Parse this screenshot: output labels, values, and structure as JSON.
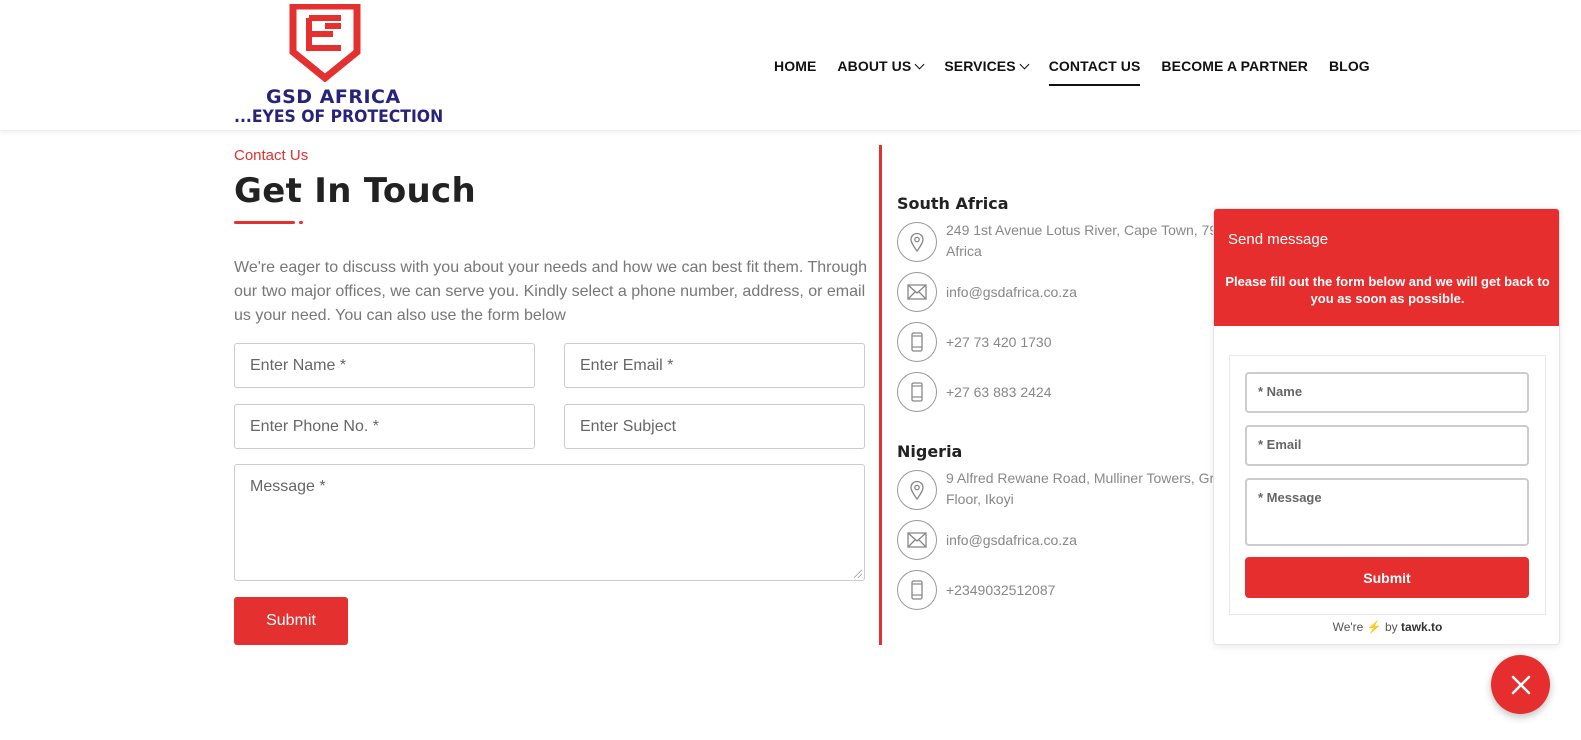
{
  "brand": {
    "name": "GSD AFRICA",
    "tagline": "...EYES OF PROTECTION",
    "colors": {
      "primary": "#e53030",
      "navy": "#27237a"
    }
  },
  "nav": {
    "items": [
      {
        "label": "HOME",
        "dropdown": false,
        "active": false
      },
      {
        "label": "ABOUT US",
        "dropdown": true,
        "active": false
      },
      {
        "label": "SERVICES",
        "dropdown": true,
        "active": false
      },
      {
        "label": "CONTACT US",
        "dropdown": false,
        "active": true
      },
      {
        "label": "BECOME A PARTNER",
        "dropdown": false,
        "active": false
      },
      {
        "label": "BLOG",
        "dropdown": false,
        "active": false
      }
    ]
  },
  "contact": {
    "eyebrow": "Contact Us",
    "title": "Get In Touch",
    "intro": "We're eager to discuss with you about your needs and how we can best fit them. Through our two major offices, we can serve you. Kindly select a phone number, address, or email us your need. You can also use the form below",
    "form": {
      "name_placeholder": "Enter Name *",
      "email_placeholder": "Enter Email *",
      "phone_placeholder": "Enter Phone No. *",
      "subject_placeholder": "Enter Subject",
      "message_placeholder": "Message *",
      "submit_label": "Submit"
    }
  },
  "offices": [
    {
      "title": "South Africa",
      "address": "249 1st Avenue Lotus River, Cape Town, 794 Africa",
      "email": "info@gsdafrica.co.za",
      "phone1": "+27 73 420 1730",
      "phone2": "+27 63 883 2424"
    },
    {
      "title": "Nigeria",
      "address": "9 Alfred Rewane Road, Mulliner Towers, Gro Floor, Ikoyi",
      "email": "info@gsdafrica.co.za",
      "phone1": "+2349032512087"
    }
  ],
  "chat_widget": {
    "title": "Send message",
    "description": "Please fill out the form below and we will get back to you as soon as possible.",
    "name_placeholder": "* Name",
    "email_placeholder": "* Email",
    "message_placeholder": "* Message",
    "submit_label": "Submit",
    "footer_prefix": "We're",
    "footer_by": "by",
    "footer_brand": "tawk.to",
    "close_icon": "close-icon"
  }
}
